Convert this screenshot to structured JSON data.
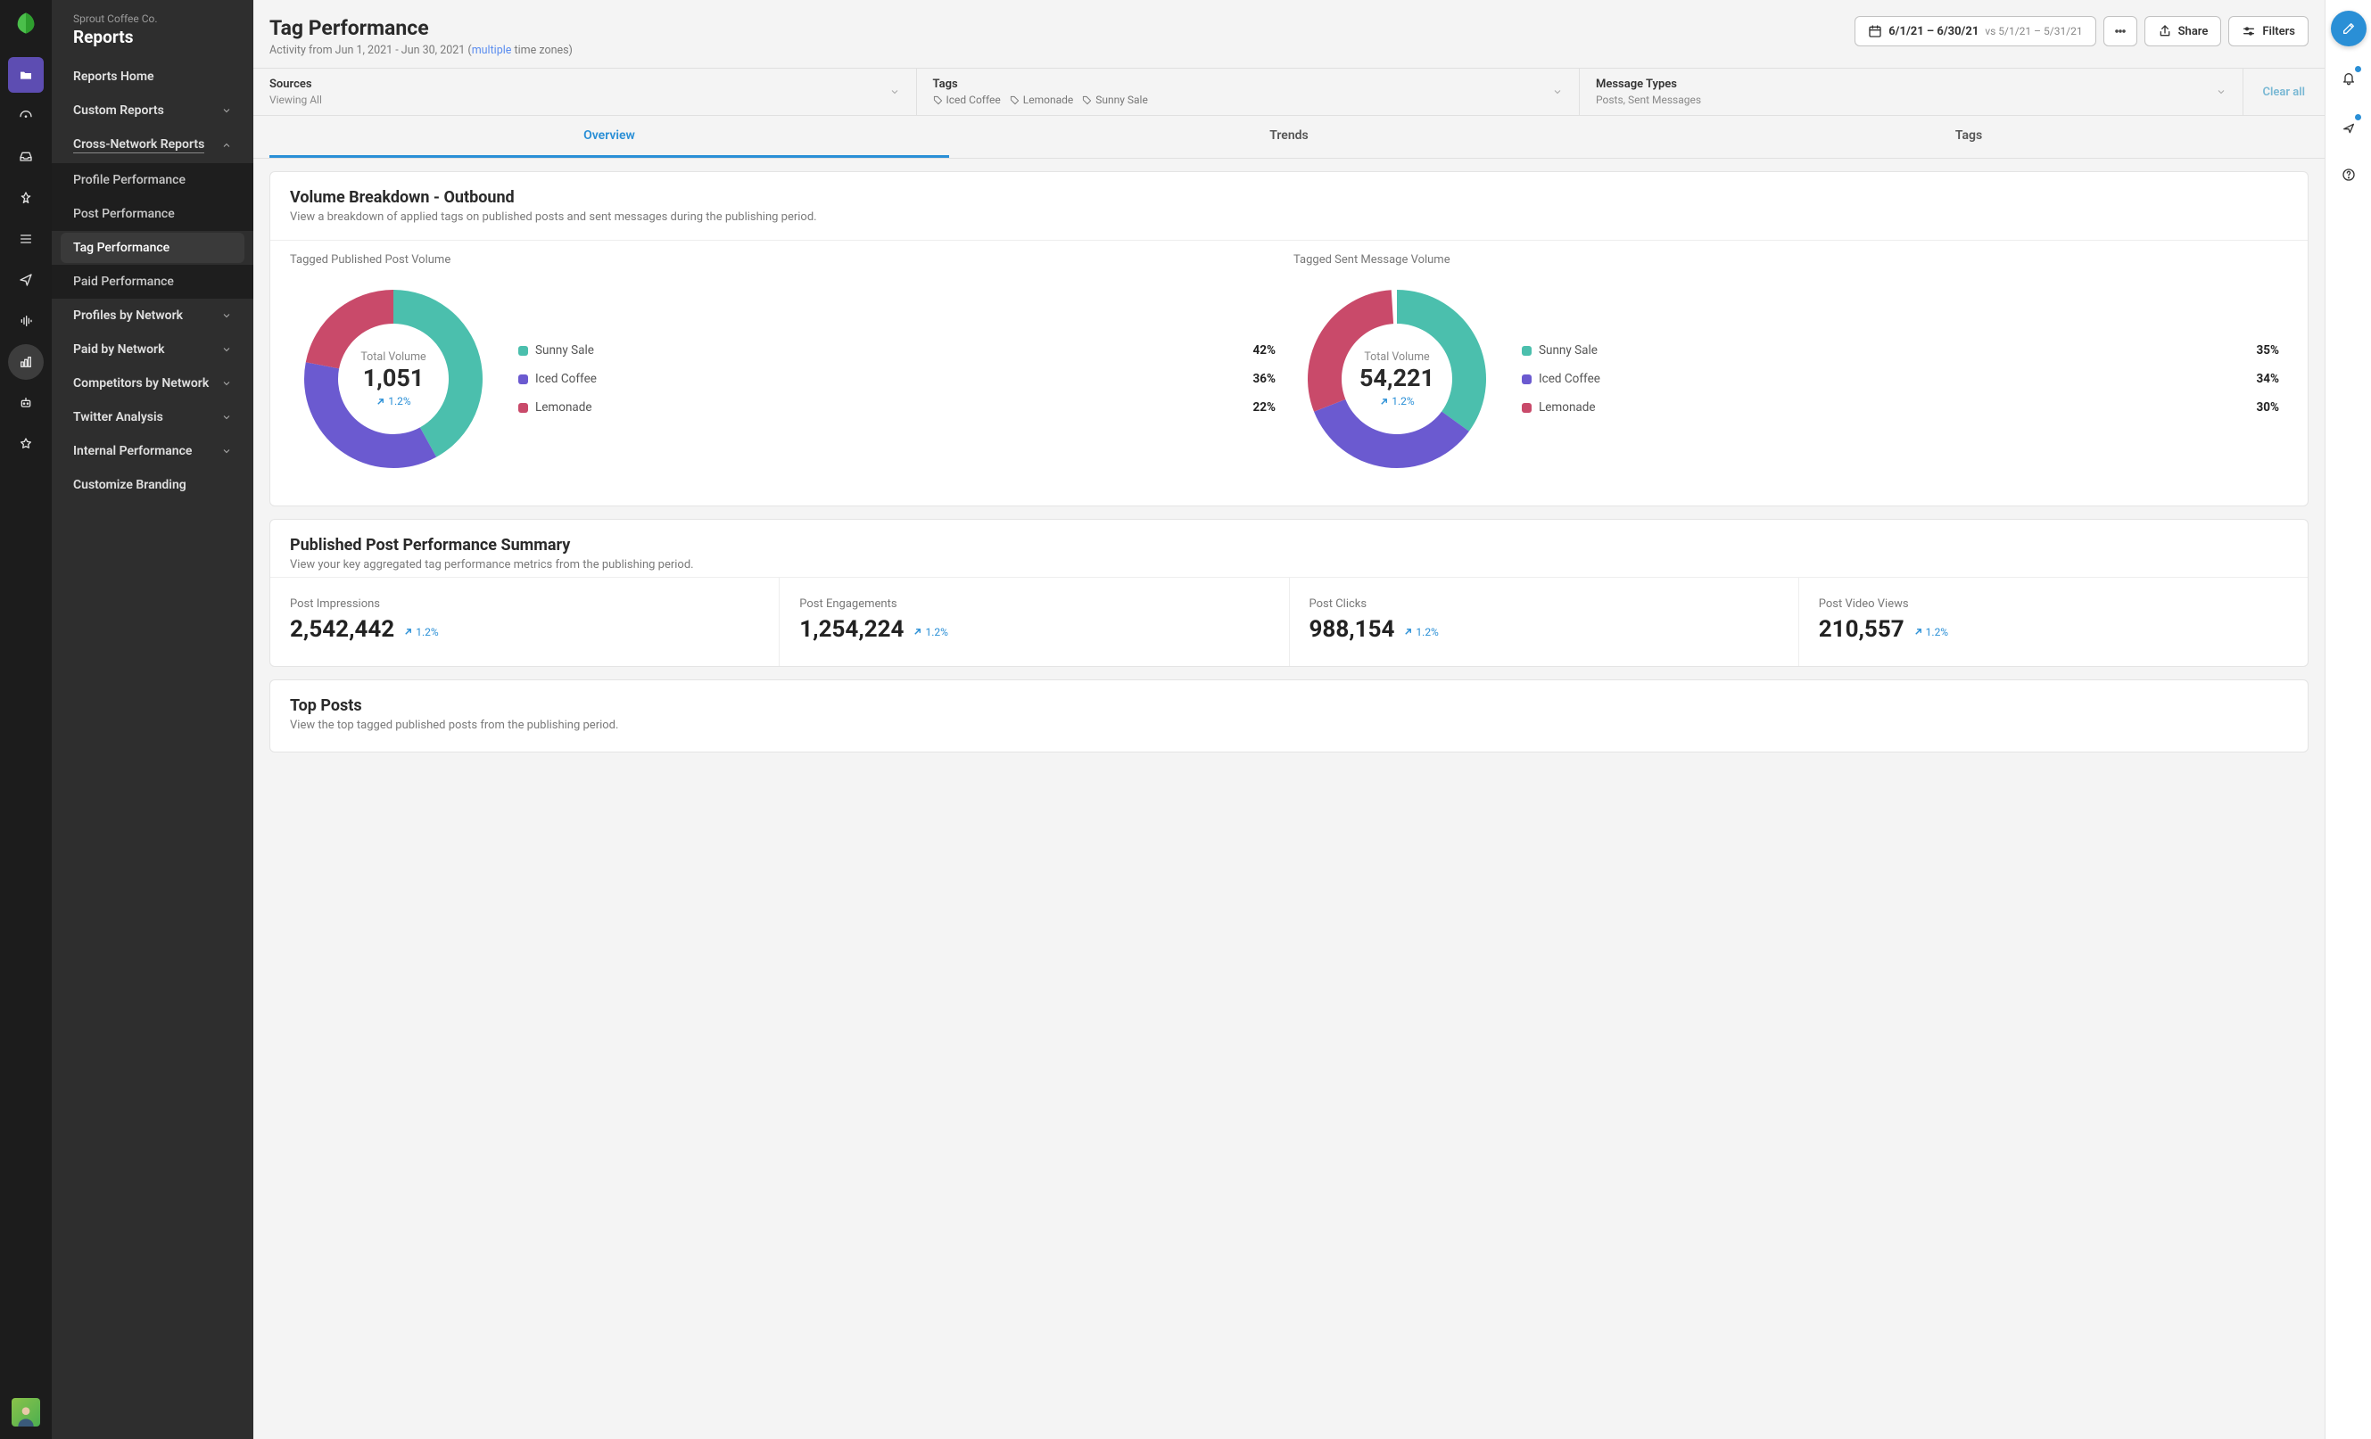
{
  "org": "Sprout Coffee Co.",
  "section": "Reports",
  "sidebar": {
    "home": "Reports Home",
    "custom": "Custom Reports",
    "cross": "Cross-Network Reports",
    "cross_items": [
      "Profile Performance",
      "Post Performance",
      "Tag Performance",
      "Paid Performance"
    ],
    "groups": [
      "Profiles by Network",
      "Paid by Network",
      "Competitors by Network",
      "Twitter Analysis",
      "Internal Performance"
    ],
    "branding": "Customize Branding"
  },
  "header": {
    "title": "Tag Performance",
    "activity_prefix": "Activity from Jun 1, 2021 - Jun 30, 2021 (",
    "activity_multi": "multiple",
    "activity_suffix": " time zones)",
    "date_main": "6/1/21 – 6/30/21",
    "date_compare": "vs 5/1/21 – 5/31/21",
    "share": "Share",
    "filters": "Filters"
  },
  "filterbar": {
    "sources": {
      "title": "Sources",
      "sub": "Viewing All"
    },
    "tags": {
      "title": "Tags",
      "items": [
        "Iced Coffee",
        "Lemonade",
        "Sunny Sale"
      ]
    },
    "types": {
      "title": "Message Types",
      "sub": "Posts, Sent Messages"
    },
    "clear": "Clear all"
  },
  "tabs": [
    "Overview",
    "Trends",
    "Tags"
  ],
  "volume": {
    "title": "Volume Breakdown - Outbound",
    "sub": "View a breakdown of applied tags on published posts and sent messages during the publishing period.",
    "center_label": "Total Volume",
    "delta": "1.2%"
  },
  "chart_data": [
    {
      "type": "pie",
      "title": "Tagged Published Post Volume",
      "total": "1,051",
      "series": [
        {
          "name": "Sunny Sale",
          "value": 42,
          "color": "#4bbfad"
        },
        {
          "name": "Iced Coffee",
          "value": 36,
          "color": "#6b5ad0"
        },
        {
          "name": "Lemonade",
          "value": 22,
          "color": "#c94a6a"
        }
      ]
    },
    {
      "type": "pie",
      "title": "Tagged Sent Message Volume",
      "total": "54,221",
      "series": [
        {
          "name": "Sunny Sale",
          "value": 35,
          "color": "#4bbfad"
        },
        {
          "name": "Iced Coffee",
          "value": 34,
          "color": "#6b5ad0"
        },
        {
          "name": "Lemonade",
          "value": 30,
          "color": "#c94a6a"
        }
      ]
    }
  ],
  "summary": {
    "title": "Published Post Performance Summary",
    "sub": "View your key aggregated tag performance metrics from the publishing period.",
    "metrics": [
      {
        "label": "Post Impressions",
        "value": "2,542,442",
        "delta": "1.2%"
      },
      {
        "label": "Post Engagements",
        "value": "1,254,224",
        "delta": "1.2%"
      },
      {
        "label": "Post Clicks",
        "value": "988,154",
        "delta": "1.2%"
      },
      {
        "label": "Post Video Views",
        "value": "210,557",
        "delta": "1.2%"
      }
    ]
  },
  "topposts": {
    "title": "Top Posts",
    "sub": "View the top tagged published posts from the publishing period."
  }
}
